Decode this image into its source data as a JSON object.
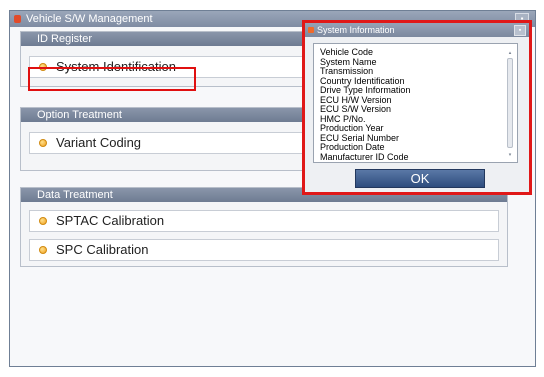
{
  "window": {
    "title": "Vehicle S/W Management"
  },
  "groups": {
    "id_register": {
      "header": "ID Register",
      "items": [
        "System Identification"
      ]
    },
    "option_treatment": {
      "header": "Option Treatment",
      "items": [
        "Variant Coding"
      ]
    },
    "data_treatment": {
      "header": "Data Treatment",
      "items": [
        "SPTAC Calibration",
        "SPC Calibration"
      ]
    }
  },
  "dialog": {
    "title": "System Information",
    "fields": [
      "Vehicle Code",
      "System Name",
      "Transmission",
      "Country Identification",
      "Drive Type Information",
      "ECU H/W Version",
      "ECU S/W Version",
      "HMC P/No.",
      "Production Year",
      "ECU Serial Number",
      "Production Date",
      "Manufacturer ID Code"
    ],
    "ok_label": "OK"
  },
  "colors": {
    "highlight": "#e01010",
    "titlebar": "#8592a8",
    "ok_button": "#3a5a8c"
  }
}
